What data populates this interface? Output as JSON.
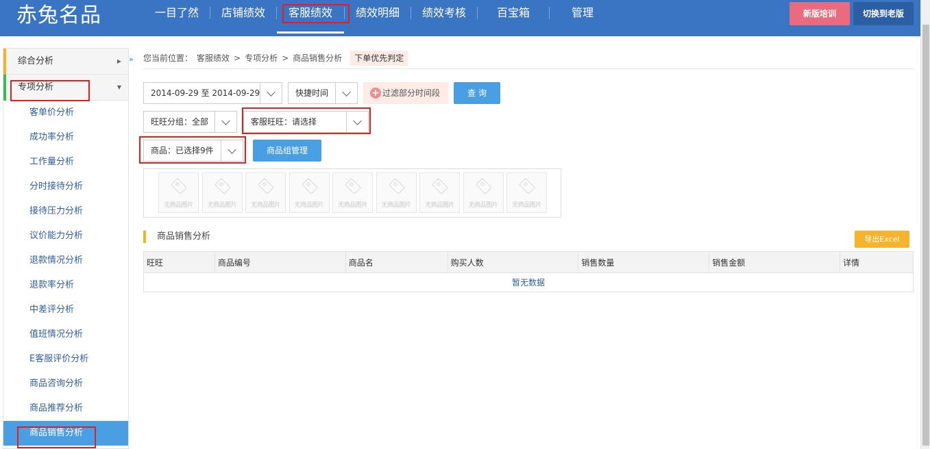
{
  "header": {
    "logo_text": "赤兔名品",
    "nav": [
      {
        "label": "一目了然"
      },
      {
        "label": "店铺绩效"
      },
      {
        "label": "客服绩效"
      },
      {
        "label": "绩效明细"
      },
      {
        "label": "绩效考核"
      },
      {
        "label": "百宝箱"
      },
      {
        "label": "管理"
      }
    ],
    "active_nav": "客服绩效",
    "train_button": "新版培训",
    "old_version_button": "切换到老版"
  },
  "sidebar": {
    "groups": [
      {
        "label": "综合分析",
        "expanded": false
      },
      {
        "label": "专项分析",
        "expanded": true
      }
    ],
    "items": [
      {
        "label": "客单价分析"
      },
      {
        "label": "成功率分析"
      },
      {
        "label": "工作量分析"
      },
      {
        "label": "分时接待分析"
      },
      {
        "label": "接待压力分析"
      },
      {
        "label": "议价能力分析"
      },
      {
        "label": "退款情况分析"
      },
      {
        "label": "退款率分析"
      },
      {
        "label": "中差评分析"
      },
      {
        "label": "值班情况分析"
      },
      {
        "label": "E客服评价分析"
      },
      {
        "label": "商品咨询分析"
      },
      {
        "label": "商品推荐分析"
      },
      {
        "label": "商品销售分析"
      }
    ],
    "active_item": "商品销售分析",
    "collapse_symbol": "»"
  },
  "breadcrumb": {
    "prefix": "您当前位置：",
    "path": [
      "客服绩效",
      "专项分析",
      "商品销售分析"
    ],
    "separator": ">",
    "tag": "下单优先判定"
  },
  "filters": {
    "date_range": "2014-09-29 至 2014-09-29",
    "quick_time": "快捷时间",
    "filter_periods": "过滤部分时间段",
    "query_button": "查 询",
    "wangwang_group": "旺旺分组：全部",
    "service_wangwang": "客服旺旺：请选择",
    "products": "商品：已选择9件",
    "product_group_button": "商品组管理"
  },
  "thumbnails": {
    "placeholder_text": "无商品图片",
    "items": [
      "无商品图片",
      "无商品图片",
      "无商品图片",
      "无商品图片",
      "无商品图片",
      "无商品图片",
      "无商品图片",
      "无商品图片",
      "无商品图片"
    ]
  },
  "report": {
    "title": "商品销售分析",
    "export_button": "导出Excel",
    "columns": [
      "旺旺",
      "商品编号",
      "商品名",
      "购买人数",
      "销售数量",
      "销售金额",
      "详情"
    ],
    "empty_text": "暂无数据"
  },
  "colors": {
    "topbar": "#3a75c4",
    "active_side": "#4a9ee2",
    "highlight": "#e02020",
    "export": "#f7b32b"
  }
}
